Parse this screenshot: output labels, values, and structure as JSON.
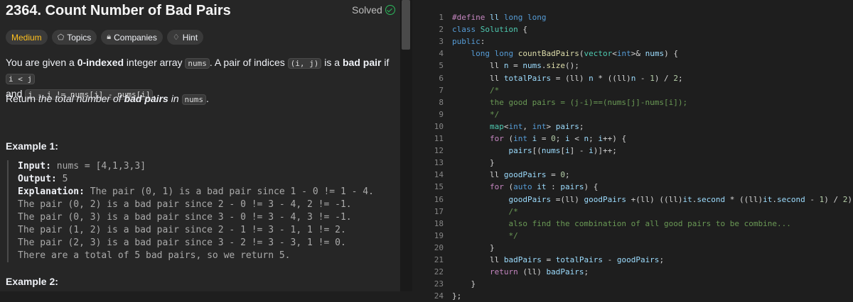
{
  "problem": {
    "title": "2364. Count Number of Bad Pairs",
    "status": "Solved",
    "tags": [
      {
        "label": "Medium",
        "icon": ""
      },
      {
        "label": "Topics",
        "icon": "tag-icon"
      },
      {
        "label": "Companies",
        "icon": "lock-icon"
      },
      {
        "label": "Hint",
        "icon": "lightbulb-icon"
      }
    ],
    "description": {
      "p1_a": "You are given a ",
      "p1_b": "0-indexed",
      "p1_c": " integer array ",
      "p1_d": "nums",
      "p1_e": ". A pair of indices ",
      "p1_f": "(i, j)",
      "p1_g": " is a ",
      "p1_h": "bad pair",
      "p1_i": " if ",
      "p1_j": "i < j",
      "p1_k": "and ",
      "p1_l": "j - i != nums[j] - nums[i]",
      "p1_m": ".",
      "p2_a": "Return ",
      "p2_b": "the total number of ",
      "p2_c": "bad pairs",
      "p2_d": " in ",
      "p2_e": "nums",
      "p2_f": "."
    },
    "example1_title": "Example 1:",
    "example1": {
      "input_label": "Input:",
      "input": " nums = [4,1,3,3]",
      "output_label": "Output:",
      "output": " 5",
      "explanation_label": "Explanation:",
      "lines": [
        " The pair (0, 1) is a bad pair since 1 - 0 != 1 - 4.",
        "The pair (0, 2) is a bad pair since 2 - 0 != 3 - 4, 2 != -1.",
        "The pair (0, 3) is a bad pair since 3 - 0 != 3 - 4, 3 != -1.",
        "The pair (1, 2) is a bad pair since 2 - 1 != 3 - 1, 1 != 2.",
        "The pair (2, 3) is a bad pair since 3 - 2 != 3 - 3, 1 != 0.",
        "There are a total of 5 bad pairs, so we return 5."
      ]
    },
    "example2_title": "Example 2:"
  },
  "editor": {
    "lines": [
      {
        "n": "1",
        "parts": [
          [
            "pp",
            "#define "
          ],
          [
            "vr",
            "ll "
          ],
          [
            "kw",
            "long long"
          ]
        ]
      },
      {
        "n": "2",
        "parts": [
          [
            "kw",
            "class "
          ],
          [
            "ty",
            "Solution"
          ],
          [
            "",
            " {"
          ]
        ]
      },
      {
        "n": "3",
        "parts": [
          [
            "kw",
            "public"
          ],
          [
            "",
            ":"
          ]
        ]
      },
      {
        "n": "4",
        "parts": [
          [
            "",
            "    "
          ],
          [
            "kw",
            "long long "
          ],
          [
            "fn",
            "countBadPairs"
          ],
          [
            "",
            "("
          ],
          [
            "ty",
            "vector"
          ],
          [
            "",
            "<"
          ],
          [
            "kw",
            "int"
          ],
          [
            "",
            ">&amp; "
          ],
          [
            "vr",
            "nums"
          ],
          [
            "",
            ") {"
          ]
        ]
      },
      {
        "n": "5",
        "parts": [
          [
            "",
            "        ll "
          ],
          [
            "vr",
            "n"
          ],
          [
            "",
            " = "
          ],
          [
            "vr",
            "nums"
          ],
          [
            "",
            "."
          ],
          [
            "fn",
            "size"
          ],
          [
            "",
            "();"
          ]
        ]
      },
      {
        "n": "6",
        "parts": [
          [
            "",
            "        ll "
          ],
          [
            "vr",
            "totalPairs"
          ],
          [
            "",
            " = (ll) "
          ],
          [
            "vr",
            "n"
          ],
          [
            "",
            " * ((ll)"
          ],
          [
            "vr",
            "n"
          ],
          [
            "",
            " - "
          ],
          [
            "nm",
            "1"
          ],
          [
            "",
            ") / "
          ],
          [
            "nm",
            "2"
          ],
          [
            "",
            ";"
          ]
        ]
      },
      {
        "n": "7",
        "parts": [
          [
            "cm",
            "        /*"
          ]
        ]
      },
      {
        "n": "8",
        "parts": [
          [
            "cm",
            "        the good pairs = (j-i)==(nums[j]-nums[i]);"
          ]
        ]
      },
      {
        "n": "9",
        "parts": [
          [
            "cm",
            "        */"
          ]
        ]
      },
      {
        "n": "10",
        "parts": [
          [
            "",
            "        "
          ],
          [
            "ty",
            "map"
          ],
          [
            "",
            "<"
          ],
          [
            "kw",
            "int"
          ],
          [
            "",
            ", "
          ],
          [
            "kw",
            "int"
          ],
          [
            "",
            "&gt; "
          ],
          [
            "vr",
            "pairs"
          ],
          [
            "",
            ";"
          ]
        ]
      },
      {
        "n": "11",
        "parts": [
          [
            "",
            "        "
          ],
          [
            "pp",
            "for"
          ],
          [
            "",
            " ("
          ],
          [
            "kw",
            "int "
          ],
          [
            "vr",
            "i"
          ],
          [
            "",
            " = "
          ],
          [
            "nm",
            "0"
          ],
          [
            "",
            "; "
          ],
          [
            "vr",
            "i"
          ],
          [
            "",
            " &lt; "
          ],
          [
            "vr",
            "n"
          ],
          [
            "",
            "; "
          ],
          [
            "vr",
            "i"
          ],
          [
            "",
            "++) {"
          ]
        ]
      },
      {
        "n": "12",
        "parts": [
          [
            "",
            "            "
          ],
          [
            "vr",
            "pairs"
          ],
          [
            "",
            "[("
          ],
          [
            "vr",
            "nums"
          ],
          [
            "",
            "["
          ],
          [
            "vr",
            "i"
          ],
          [
            "",
            "] - "
          ],
          [
            "vr",
            "i"
          ],
          [
            "",
            ")]++;"
          ]
        ]
      },
      {
        "n": "13",
        "parts": [
          [
            "",
            "        }"
          ]
        ]
      },
      {
        "n": "14",
        "parts": [
          [
            "",
            "        ll "
          ],
          [
            "vr",
            "goodPairs"
          ],
          [
            "",
            " = "
          ],
          [
            "nm",
            "0"
          ],
          [
            "",
            ";"
          ]
        ]
      },
      {
        "n": "15",
        "parts": [
          [
            "",
            "        "
          ],
          [
            "pp",
            "for"
          ],
          [
            "",
            " ("
          ],
          [
            "kw",
            "auto "
          ],
          [
            "vr",
            "it"
          ],
          [
            "",
            " : "
          ],
          [
            "vr",
            "pairs"
          ],
          [
            "",
            ") {"
          ]
        ]
      },
      {
        "n": "16",
        "parts": [
          [
            "",
            "            "
          ],
          [
            "vr",
            "goodPairs"
          ],
          [
            "",
            " =(ll) "
          ],
          [
            "vr",
            "goodPairs"
          ],
          [
            "",
            " +(ll) ((ll)"
          ],
          [
            "vr",
            "it"
          ],
          [
            "",
            "."
          ],
          [
            "vr",
            "second"
          ],
          [
            "",
            " * ((ll)"
          ],
          [
            "vr",
            "it"
          ],
          [
            "",
            "."
          ],
          [
            "vr",
            "second"
          ],
          [
            "",
            " - "
          ],
          [
            "nm",
            "1"
          ],
          [
            "",
            ") / "
          ],
          [
            "nm",
            "2"
          ],
          [
            "",
            ");"
          ]
        ]
      },
      {
        "n": "17",
        "parts": [
          [
            "cm",
            "            /*"
          ]
        ]
      },
      {
        "n": "18",
        "parts": [
          [
            "cm",
            "            also find the combination of all good pairs to be combine..."
          ]
        ]
      },
      {
        "n": "19",
        "parts": [
          [
            "cm",
            "            */"
          ]
        ]
      },
      {
        "n": "20",
        "parts": [
          [
            "",
            "        }"
          ]
        ]
      },
      {
        "n": "21",
        "parts": [
          [
            "",
            "        ll "
          ],
          [
            "vr",
            "badPairs"
          ],
          [
            "",
            " = "
          ],
          [
            "vr",
            "totalPairs"
          ],
          [
            "",
            " - "
          ],
          [
            "vr",
            "goodPairs"
          ],
          [
            "",
            ";"
          ]
        ]
      },
      {
        "n": "22",
        "parts": [
          [
            "",
            "        "
          ],
          [
            "pp",
            "return"
          ],
          [
            "",
            " (ll) "
          ],
          [
            "vr",
            "badPairs"
          ],
          [
            "",
            ";"
          ]
        ]
      },
      {
        "n": "23",
        "parts": [
          [
            "",
            "    }"
          ]
        ]
      },
      {
        "n": "24",
        "parts": [
          [
            "",
            "};"
          ]
        ]
      }
    ]
  }
}
